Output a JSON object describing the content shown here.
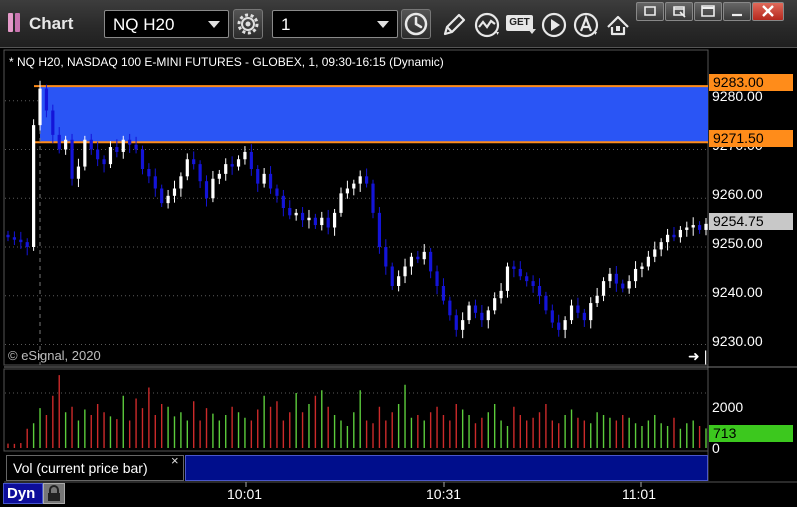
{
  "app": {
    "title": "Chart",
    "symbol": "NQ H20",
    "interval": "1",
    "get_label": "GET",
    "icons": [
      "app-logo-icon",
      "settings-gear-icon",
      "clock-icon",
      "pencil-icon",
      "study-wave-icon",
      "get-icon",
      "play-icon",
      "alert-icon",
      "navigate-arrows-icon",
      "restore-icon",
      "float-icon",
      "maximize-icon",
      "close-icon"
    ]
  },
  "chart": {
    "header": "* NQ H20, NASDAQ 100 E-MINI FUTURES - GLOBEX, 1, 09:30-16:15 (Dynamic)",
    "copyright": "© eSignal, 2020",
    "price_labels": [
      "9280.00",
      "9270.00",
      "9260.00",
      "9250.00",
      "9240.00",
      "9230.00"
    ],
    "tags": {
      "upper": "9283.00",
      "lower": "9271.50",
      "last": "9254.75"
    },
    "time_labels": [
      "10:01",
      "10:31",
      "11:01"
    ],
    "volume_labels": [
      "2000",
      "0"
    ],
    "volume_last": "713",
    "study_name": "Vol (current price bar)",
    "study_close": "×",
    "dyn_label": "Dyn"
  },
  "colors": {
    "background": "#000000",
    "zone_fill": "#2a55f5",
    "zone_line": "#ff8c1a",
    "bull": "#ffffff",
    "bear": "#1414d8",
    "vol_up": "#5ccc3c",
    "vol_down": "#cc2a2a",
    "last_tag": "#c8c8c8",
    "vol_tag": "#3cc81e"
  },
  "chart_data": {
    "type": "candlestick",
    "instrument": "NQ H20",
    "interval": "1",
    "ylim": [
      9226,
      9290
    ],
    "y_ticks": [
      9230,
      9240,
      9250,
      9260,
      9270,
      9280
    ],
    "zone": [
      9271.5,
      9283.0
    ],
    "last_price": 9254.75,
    "x_ticks": [
      "10:01",
      "10:31",
      "11:01"
    ],
    "series": [
      {
        "name": "price",
        "closes": [
          9252.0,
          9251.5,
          9251.0,
          9250.0,
          9275.0,
          9282.5,
          9278.0,
          9273.0,
          9270.0,
          9272.0,
          9264.0,
          9266.5,
          9272.0,
          9270.0,
          9268.0,
          9267.0,
          9270.5,
          9269.5,
          9272.0,
          9271.0,
          9270.0,
          9266.0,
          9264.5,
          9262.0,
          9259.0,
          9260.5,
          9262.0,
          9264.5,
          9268.0,
          9267.0,
          9263.5,
          9260.0,
          9264.0,
          9265.0,
          9267.0,
          9266.5,
          9268.0,
          9269.5,
          9266.0,
          9263.0,
          9265.0,
          9262.0,
          9260.5,
          9258.0,
          9256.5,
          9257.0,
          9255.5,
          9256.0,
          9254.5,
          9256.0,
          9254.0,
          9257.0,
          9261.0,
          9262.0,
          9263.0,
          9264.5,
          9263.0,
          9257.0,
          9250.0,
          9246.0,
          9242.0,
          9244.0,
          9246.0,
          9248.0,
          9247.5,
          9249.0,
          9245.0,
          9242.0,
          9239.0,
          9236.0,
          9233.0,
          9235.0,
          9238.0,
          9236.5,
          9235.0,
          9237.0,
          9239.5,
          9241.0,
          9246.0,
          9245.5,
          9244.0,
          9243.0,
          9242.0,
          9240.0,
          9237.0,
          9234.5,
          9233.0,
          9235.0,
          9238.0,
          9236.5,
          9235.0,
          9238.5,
          9240.0,
          9243.0,
          9244.5,
          9242.5,
          9241.5,
          9243.0,
          9245.5,
          9246.0,
          9248.0,
          9249.5,
          9251.0,
          9252.5,
          9252.0,
          9253.5,
          9254.0,
          9254.5,
          9253.5,
          9254.75
        ]
      },
      {
        "name": "volume",
        "values": [
          160,
          150,
          180,
          700,
          900,
          1450,
          1200,
          1900,
          2650,
          1300,
          1500,
          1000,
          1400,
          1200,
          1600,
          1300,
          1150,
          1050,
          1900,
          1000,
          1800,
          1450,
          2200,
          1200,
          1600,
          1500,
          1150,
          1300,
          1000,
          1700,
          1000,
          1450,
          1250,
          1000,
          1200,
          1500,
          1300,
          1100,
          1000,
          1400,
          1900,
          1500,
          1700,
          1000,
          1300,
          2000,
          1300,
          1600,
          1900,
          2100,
          1500,
          1200,
          1000,
          800,
          1300,
          2100,
          1000,
          900,
          1500,
          1000,
          1300,
          1600,
          2300,
          1100,
          1200,
          1000,
          1300,
          1500,
          1200,
          1000,
          1600,
          1400,
          1200,
          900,
          1100,
          1300,
          1600,
          1000,
          800,
          1500,
          1200,
          1000,
          1100,
          1300,
          1600,
          1000,
          900,
          1200,
          1400,
          1100,
          1000,
          900,
          1300,
          1200,
          1100,
          1000,
          1200,
          1100,
          900,
          800,
          1000,
          1200,
          900,
          800,
          1100,
          700,
          900,
          1000,
          800,
          713
        ]
      }
    ]
  }
}
